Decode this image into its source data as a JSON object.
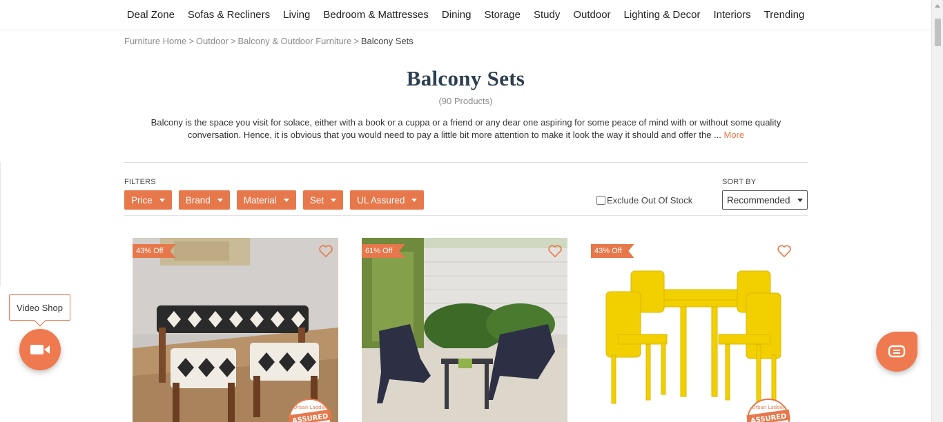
{
  "nav": {
    "items": [
      "Deal Zone",
      "Sofas & Recliners",
      "Living",
      "Bedroom & Mattresses",
      "Dining",
      "Storage",
      "Study",
      "Outdoor",
      "Lighting & Decor",
      "Interiors",
      "Trending"
    ]
  },
  "breadcrumb": {
    "items": [
      "Furniture Home",
      "Outdoor",
      "Balcony & Outdoor Furniture"
    ],
    "separator": ">",
    "current": "Balcony Sets"
  },
  "page": {
    "title": "Balcony Sets",
    "count": "(90 Products)",
    "description": "Balcony is the space you visit for solace, either with a book or a cuppa or a friend or any dear one aspiring for some peace of mind with or without some quality conversation. Hence, it is obvious that you would need to pay a little bit more attention to make it look the way it should and offer the ... ",
    "more_label": "More"
  },
  "filters": {
    "label": "FILTERS",
    "buttons": [
      "Price",
      "Brand",
      "Material",
      "Set",
      "UL Assured"
    ],
    "exclude_label": "Exclude Out Of Stock",
    "exclude_checked": false
  },
  "sort": {
    "label": "SORT BY",
    "selected": "Recommended"
  },
  "products": [
    {
      "discount": "43% Off",
      "assured": true
    },
    {
      "discount": "61% Off",
      "assured": false
    },
    {
      "discount": "43% Off",
      "assured": true
    }
  ],
  "assured_badge": {
    "top_text": "Urban Ladder",
    "main_text": "ASSURED"
  },
  "widgets": {
    "video_shop_label": "Video Shop"
  },
  "colors": {
    "accent": "#e6784b",
    "title": "#2c3e50"
  }
}
